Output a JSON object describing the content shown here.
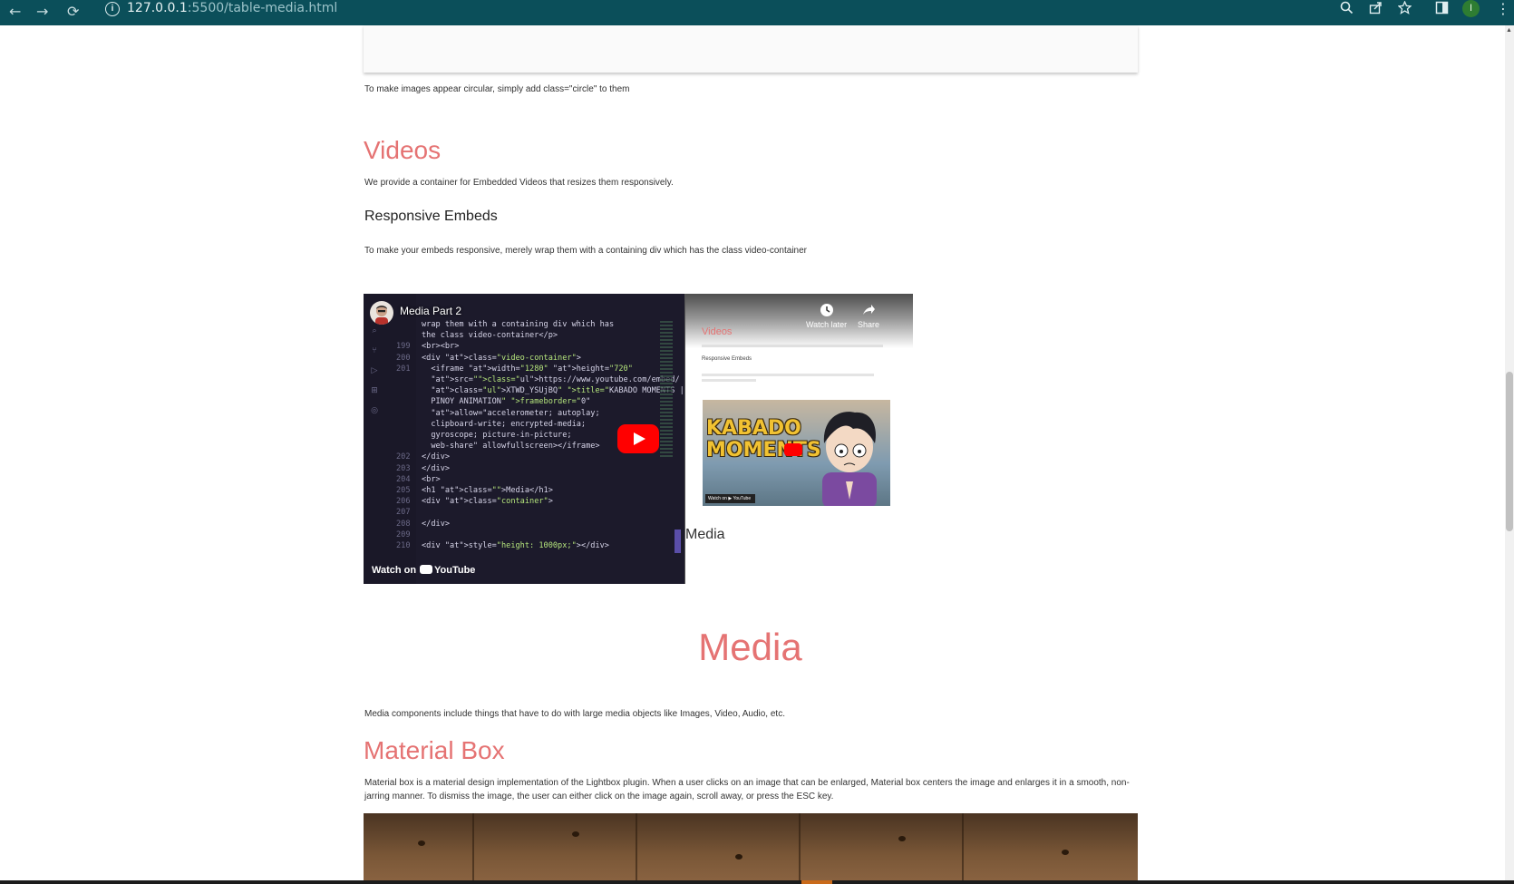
{
  "browser": {
    "back": "←",
    "forward": "→",
    "reload": "⟳",
    "url_host": "127.0.0.1",
    "url_rest": ":5500/table-media.html",
    "profile_initial": "I",
    "icons": [
      "zoom-icon",
      "share-icon",
      "star-icon",
      "sidepanel-icon",
      "profile-avatar",
      "menu-icon"
    ]
  },
  "page": {
    "circle_note": "To make images appear circular, simply add class=\"circle\" to them",
    "videos_heading": "Videos",
    "videos_desc": "We provide a container for Embedded Videos that resizes them responsively.",
    "responsive_heading": "Responsive Embeds",
    "responsive_desc": "To make your embeds responsive, merely wrap them with a containing div which has the class video-container",
    "media_heading": "Media",
    "media_desc": "Media components include things that have to do with large media objects like Images, Video, Audio, etc.",
    "material_heading": "Material Box",
    "material_desc_1": "Material box is a material design implementation of the Lightbox plugin. When a user clicks on an image that can be enlarged, Material box centers the image and enlarges it in a smooth, non-",
    "material_desc_2": "jarring manner. To dismiss the image, the user can either click on the image again, scroll away, or press the ESC key."
  },
  "video": {
    "title": "Media Part 2",
    "watch_on": "Watch on",
    "youtube": "YouTube",
    "watch_later": "Watch later",
    "share": "Share",
    "inner_videos_heading": "Videos",
    "inner_responsive": "Responsive Embeds",
    "inner_thumb_text": "KABADO MOMENTS",
    "inner_media_heading": "Media",
    "code_lines": [
      {
        "ln": "",
        "text": "wrap them with a containing div which has"
      },
      {
        "ln": "",
        "text": "the class video-container</p>"
      },
      {
        "ln": "199",
        "text": "<br><br>"
      },
      {
        "ln": "200",
        "text": "<div class=\"video-container\">"
      },
      {
        "ln": "201",
        "text": "  <iframe width=\"1280\" height=\"720\""
      },
      {
        "ln": "",
        "text": "  src=\"https://www.youtube.com/embed/"
      },
      {
        "ln": "",
        "text": "  XTWD_YSUjBQ\" title=\"KABADO MOMENTS |"
      },
      {
        "ln": "",
        "text": "  PINOY ANIMATION\" frameborder=\"0\""
      },
      {
        "ln": "",
        "text": "  allow=\"accelerometer; autoplay;"
      },
      {
        "ln": "",
        "text": "  clipboard-write; encrypted-media;"
      },
      {
        "ln": "",
        "text": "  gyroscope; picture-in-picture;"
      },
      {
        "ln": "",
        "text": "  web-share\" allowfullscreen></iframe>"
      },
      {
        "ln": "202",
        "text": "</div>"
      },
      {
        "ln": "203",
        "text": "</div>"
      },
      {
        "ln": "204",
        "text": "<br>"
      },
      {
        "ln": "205",
        "text": "<h1 class=\"\">Media</h1>"
      },
      {
        "ln": "206",
        "text": "<div class=\"container\">"
      },
      {
        "ln": "207",
        "text": ""
      },
      {
        "ln": "208",
        "text": "</div>"
      },
      {
        "ln": "209",
        "text": ""
      },
      {
        "ln": "210",
        "text": "<div style=\"height: 1000px;\"></div>"
      }
    ]
  },
  "colors": {
    "heading_red": "#e57373",
    "chrome_bg": "#0b4f5a",
    "youtube_red": "#ff0000"
  }
}
